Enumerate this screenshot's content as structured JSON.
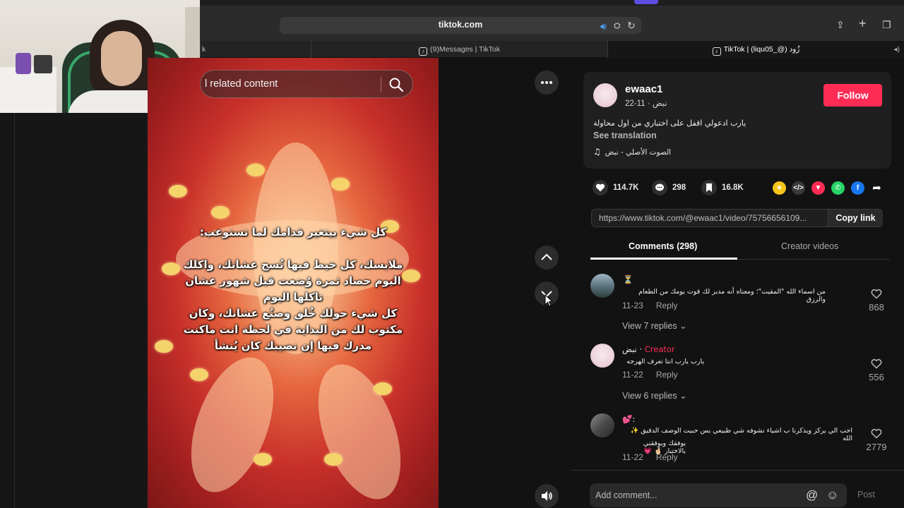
{
  "browser": {
    "url": "tiktok.com",
    "tabs": [
      {
        "label": "k",
        "active": false
      },
      {
        "label": "(9)Messages | TikTok",
        "active": false
      },
      {
        "label": "TikTok | (liqu05_@) زُود",
        "active": true
      }
    ]
  },
  "video": {
    "search_placeholder": "l related content",
    "caption_lines": [
      "كل شيء بيتغير قدامك لما تستوعب:",
      "",
      "ملابسك، كل خيط فيها نُسج عشانك، واكلك",
      "اليوم حصاد ثمرة وُضعت قبل شهور عشان",
      "تاكلها اليوم",
      "كل شيء حولك خُلق وصنُع عشانك، وكان",
      "مكتوب لك من البداية في لحظة انت ماكنت",
      "مدرك فيها إن نصيبك كان يُنشأ"
    ]
  },
  "post": {
    "author": "ewaac1",
    "meta": "نبض · 11-22",
    "description": "يارب ادعولي اقفل على اختباري من اول محاولة",
    "see_translation": "See translation",
    "music": "الصوت الأصلي - نبض",
    "follow_label": "Follow",
    "likes": "114.7K",
    "comments": "298",
    "saves": "16.8K",
    "link": "https://www.tiktok.com/@ewaac1/video/75756656109...",
    "copy_link_label": "Copy link"
  },
  "tabs": {
    "comments": "Comments (298)",
    "creator_videos": "Creator videos"
  },
  "comments": [
    {
      "name": "⏳",
      "text": "من اسماء الله \"المقيت\"؛ ومعناه أنه مدبر لك قوت يومك من الطعام والرزق",
      "date": "11-23",
      "reply": "Reply",
      "likes": "868",
      "view_replies": "View 7 replies"
    },
    {
      "name": "نبض ·",
      "creator_label": "Creator",
      "text": "يارب يارب انتا تعرف الهرجه",
      "date": "11-22",
      "reply": "Reply",
      "likes": "556",
      "view_replies": "View 6 replies"
    },
    {
      "name": "💕:",
      "text": "احب الي يركز ويذكرنا ب اشياء نشوفه شي طبيعي بس حبيت الوصف الدقيق ✨ الله",
      "text2": "يوفقك ويوفقني بالاختبار 🤞🏻 💗",
      "date": "11-22",
      "reply": "Reply",
      "likes": "2779"
    }
  ],
  "footer": {
    "input_placeholder": "Add comment...",
    "post_label": "Post"
  },
  "colors": {
    "accent": "#fe2c55",
    "background": "#121212",
    "card": "#1f1f1f"
  }
}
